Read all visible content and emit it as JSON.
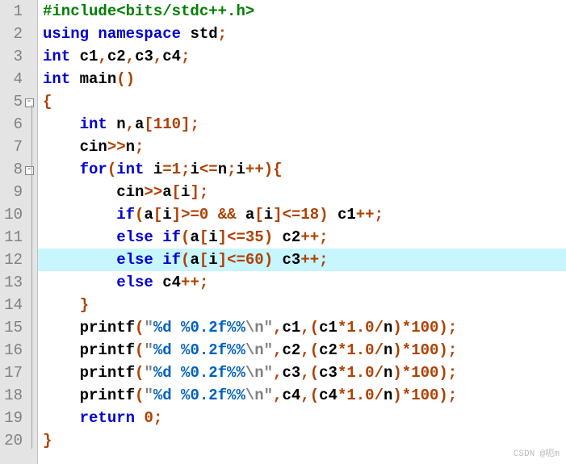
{
  "chart_data": null,
  "watermark": "CSDN @呃m",
  "highlight_line": 12,
  "folds": [
    {
      "line": 5,
      "type": "open"
    },
    {
      "line": 8,
      "type": "open"
    }
  ],
  "fold_bar_ranges": [
    {
      "from": 5,
      "to": 20
    }
  ],
  "lines": [
    {
      "n": 1,
      "segs": [
        [
          "t-preproc",
          "#include<bits/stdc++.h>"
        ]
      ]
    },
    {
      "n": 2,
      "segs": [
        [
          "t-keyword",
          "using"
        ],
        [
          "t-normal",
          " "
        ],
        [
          "t-keyword",
          "namespace"
        ],
        [
          "t-normal",
          " std"
        ],
        [
          "t-punct",
          ";"
        ]
      ]
    },
    {
      "n": 3,
      "segs": [
        [
          "t-keyword",
          "int"
        ],
        [
          "t-normal",
          " c1"
        ],
        [
          "t-punct",
          ","
        ],
        [
          "t-normal",
          "c2"
        ],
        [
          "t-punct",
          ","
        ],
        [
          "t-normal",
          "c3"
        ],
        [
          "t-punct",
          ","
        ],
        [
          "t-normal",
          "c4"
        ],
        [
          "t-punct",
          ";"
        ]
      ]
    },
    {
      "n": 4,
      "segs": [
        [
          "t-keyword",
          "int"
        ],
        [
          "t-normal",
          " main"
        ],
        [
          "t-punct",
          "()"
        ]
      ]
    },
    {
      "n": 5,
      "segs": [
        [
          "t-brace",
          "{"
        ]
      ]
    },
    {
      "n": 6,
      "segs": [
        [
          "t-normal",
          "    "
        ],
        [
          "t-keyword",
          "int"
        ],
        [
          "t-normal",
          " n"
        ],
        [
          "t-punct",
          ","
        ],
        [
          "t-normal",
          "a"
        ],
        [
          "t-punct",
          "["
        ],
        [
          "t-number",
          "110"
        ],
        [
          "t-punct",
          "];"
        ]
      ]
    },
    {
      "n": 7,
      "segs": [
        [
          "t-normal",
          "    cin"
        ],
        [
          "t-op",
          ">>"
        ],
        [
          "t-normal",
          "n"
        ],
        [
          "t-punct",
          ";"
        ]
      ]
    },
    {
      "n": 8,
      "segs": [
        [
          "t-normal",
          "    "
        ],
        [
          "t-keyword",
          "for"
        ],
        [
          "t-punct",
          "("
        ],
        [
          "t-keyword",
          "int"
        ],
        [
          "t-normal",
          " i"
        ],
        [
          "t-op",
          "="
        ],
        [
          "t-number",
          "1"
        ],
        [
          "t-punct",
          ";"
        ],
        [
          "t-normal",
          "i"
        ],
        [
          "t-op",
          "<="
        ],
        [
          "t-normal",
          "n"
        ],
        [
          "t-punct",
          ";"
        ],
        [
          "t-normal",
          "i"
        ],
        [
          "t-op",
          "++"
        ],
        [
          "t-punct",
          ")"
        ],
        [
          "t-brace",
          "{"
        ]
      ]
    },
    {
      "n": 9,
      "segs": [
        [
          "t-normal",
          "        cin"
        ],
        [
          "t-op",
          ">>"
        ],
        [
          "t-normal",
          "a"
        ],
        [
          "t-punct",
          "["
        ],
        [
          "t-normal",
          "i"
        ],
        [
          "t-punct",
          "];"
        ]
      ]
    },
    {
      "n": 10,
      "segs": [
        [
          "t-normal",
          "        "
        ],
        [
          "t-keyword",
          "if"
        ],
        [
          "t-punct",
          "("
        ],
        [
          "t-normal",
          "a"
        ],
        [
          "t-punct",
          "["
        ],
        [
          "t-normal",
          "i"
        ],
        [
          "t-punct",
          "]"
        ],
        [
          "t-op",
          ">="
        ],
        [
          "t-number",
          "0"
        ],
        [
          "t-normal",
          " "
        ],
        [
          "t-op",
          "&&"
        ],
        [
          "t-normal",
          " a"
        ],
        [
          "t-punct",
          "["
        ],
        [
          "t-normal",
          "i"
        ],
        [
          "t-punct",
          "]"
        ],
        [
          "t-op",
          "<="
        ],
        [
          "t-number",
          "18"
        ],
        [
          "t-punct",
          ")"
        ],
        [
          "t-normal",
          " c1"
        ],
        [
          "t-op",
          "++"
        ],
        [
          "t-punct",
          ";"
        ]
      ]
    },
    {
      "n": 11,
      "segs": [
        [
          "t-normal",
          "        "
        ],
        [
          "t-keyword",
          "else"
        ],
        [
          "t-normal",
          " "
        ],
        [
          "t-keyword",
          "if"
        ],
        [
          "t-punct",
          "("
        ],
        [
          "t-normal",
          "a"
        ],
        [
          "t-punct",
          "["
        ],
        [
          "t-normal",
          "i"
        ],
        [
          "t-punct",
          "]"
        ],
        [
          "t-op",
          "<="
        ],
        [
          "t-number",
          "35"
        ],
        [
          "t-punct",
          ")"
        ],
        [
          "t-normal",
          " c2"
        ],
        [
          "t-op",
          "++"
        ],
        [
          "t-punct",
          ";"
        ]
      ]
    },
    {
      "n": 12,
      "segs": [
        [
          "t-normal",
          "        "
        ],
        [
          "t-keyword",
          "else"
        ],
        [
          "t-normal",
          " "
        ],
        [
          "t-keyword",
          "if"
        ],
        [
          "t-punct",
          "("
        ],
        [
          "t-normal",
          "a"
        ],
        [
          "t-punct",
          "["
        ],
        [
          "t-normal",
          "i"
        ],
        [
          "t-punct",
          "]"
        ],
        [
          "t-op",
          "<="
        ],
        [
          "t-number",
          "60"
        ],
        [
          "t-punct",
          ")"
        ],
        [
          "t-normal",
          " c3"
        ],
        [
          "t-op",
          "++"
        ],
        [
          "t-punct",
          ";"
        ]
      ]
    },
    {
      "n": 13,
      "segs": [
        [
          "t-normal",
          "        "
        ],
        [
          "t-keyword",
          "else"
        ],
        [
          "t-normal",
          " c4"
        ],
        [
          "t-op",
          "++"
        ],
        [
          "t-punct",
          ";"
        ]
      ]
    },
    {
      "n": 14,
      "segs": [
        [
          "t-normal",
          "    "
        ],
        [
          "t-brace",
          "}"
        ]
      ]
    },
    {
      "n": 15,
      "segs": [
        [
          "t-normal",
          "    printf"
        ],
        [
          "t-punct",
          "("
        ],
        [
          "t-string",
          "\""
        ],
        [
          "t-fmt",
          "%d %0.2f%%"
        ],
        [
          "t-string",
          "\\n\""
        ],
        [
          "t-punct",
          ","
        ],
        [
          "t-normal",
          "c1"
        ],
        [
          "t-punct",
          ",("
        ],
        [
          "t-normal",
          "c1"
        ],
        [
          "t-op",
          "*"
        ],
        [
          "t-number",
          "1.0"
        ],
        [
          "t-op",
          "/"
        ],
        [
          "t-normal",
          "n"
        ],
        [
          "t-punct",
          ")"
        ],
        [
          "t-op",
          "*"
        ],
        [
          "t-number",
          "100"
        ],
        [
          "t-punct",
          ");"
        ]
      ]
    },
    {
      "n": 16,
      "segs": [
        [
          "t-normal",
          "    printf"
        ],
        [
          "t-punct",
          "("
        ],
        [
          "t-string",
          "\""
        ],
        [
          "t-fmt",
          "%d %0.2f%%"
        ],
        [
          "t-string",
          "\\n\""
        ],
        [
          "t-punct",
          ","
        ],
        [
          "t-normal",
          "c2"
        ],
        [
          "t-punct",
          ",("
        ],
        [
          "t-normal",
          "c2"
        ],
        [
          "t-op",
          "*"
        ],
        [
          "t-number",
          "1.0"
        ],
        [
          "t-op",
          "/"
        ],
        [
          "t-normal",
          "n"
        ],
        [
          "t-punct",
          ")"
        ],
        [
          "t-op",
          "*"
        ],
        [
          "t-number",
          "100"
        ],
        [
          "t-punct",
          ");"
        ]
      ]
    },
    {
      "n": 17,
      "segs": [
        [
          "t-normal",
          "    printf"
        ],
        [
          "t-punct",
          "("
        ],
        [
          "t-string",
          "\""
        ],
        [
          "t-fmt",
          "%d %0.2f%%"
        ],
        [
          "t-string",
          "\\n\""
        ],
        [
          "t-punct",
          ","
        ],
        [
          "t-normal",
          "c3"
        ],
        [
          "t-punct",
          ",("
        ],
        [
          "t-normal",
          "c3"
        ],
        [
          "t-op",
          "*"
        ],
        [
          "t-number",
          "1.0"
        ],
        [
          "t-op",
          "/"
        ],
        [
          "t-normal",
          "n"
        ],
        [
          "t-punct",
          ")"
        ],
        [
          "t-op",
          "*"
        ],
        [
          "t-number",
          "100"
        ],
        [
          "t-punct",
          ");"
        ]
      ]
    },
    {
      "n": 18,
      "segs": [
        [
          "t-normal",
          "    printf"
        ],
        [
          "t-punct",
          "("
        ],
        [
          "t-string",
          "\""
        ],
        [
          "t-fmt",
          "%d %0.2f%%"
        ],
        [
          "t-string",
          "\\n\""
        ],
        [
          "t-punct",
          ","
        ],
        [
          "t-normal",
          "c4"
        ],
        [
          "t-punct",
          ",("
        ],
        [
          "t-normal",
          "c4"
        ],
        [
          "t-op",
          "*"
        ],
        [
          "t-number",
          "1.0"
        ],
        [
          "t-op",
          "/"
        ],
        [
          "t-normal",
          "n"
        ],
        [
          "t-punct",
          ")"
        ],
        [
          "t-op",
          "*"
        ],
        [
          "t-number",
          "100"
        ],
        [
          "t-punct",
          ");"
        ]
      ]
    },
    {
      "n": 19,
      "segs": [
        [
          "t-normal",
          "    "
        ],
        [
          "t-keyword",
          "return"
        ],
        [
          "t-normal",
          " "
        ],
        [
          "t-number",
          "0"
        ],
        [
          "t-punct",
          ";"
        ]
      ]
    },
    {
      "n": 20,
      "segs": [
        [
          "t-brace",
          "}"
        ]
      ]
    }
  ]
}
